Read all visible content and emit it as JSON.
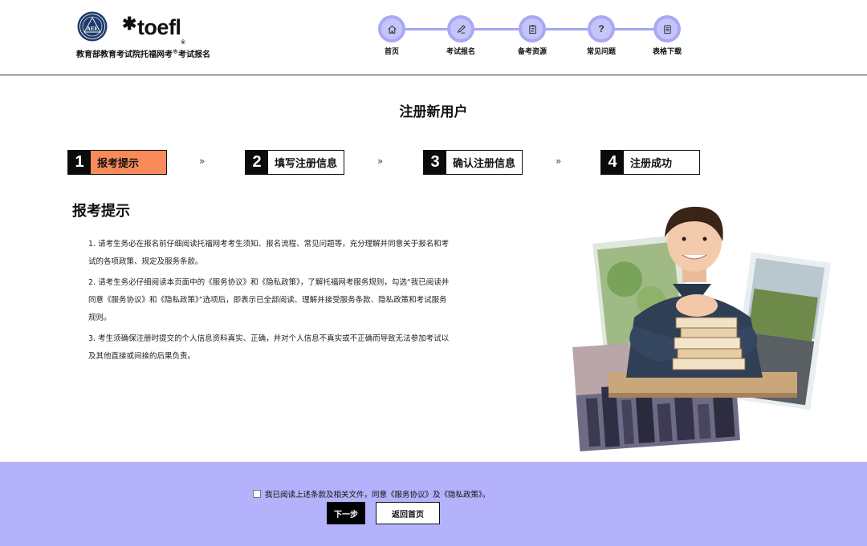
{
  "header": {
    "aee_logo_text": "AEE",
    "toefl_logo": "toefl",
    "org_name_prefix": "教育部教育考试院托福网考",
    "org_name_reg": "®",
    "org_name_suffix": "考试报名",
    "nav": [
      {
        "label": "首页",
        "icon": "home-icon"
      },
      {
        "label": "考试报名",
        "icon": "pencil-edit-icon"
      },
      {
        "label": "备考资源",
        "icon": "clipboard-icon"
      },
      {
        "label": "常见问题",
        "icon": "question-icon"
      },
      {
        "label": "表格下载",
        "icon": "document-icon"
      }
    ]
  },
  "page": {
    "title": "注册新用户",
    "steps": [
      {
        "num": "1",
        "label": "报考提示",
        "active": true
      },
      {
        "num": "2",
        "label": "填写注册信息",
        "active": false
      },
      {
        "num": "3",
        "label": "确认注册信息",
        "active": false
      },
      {
        "num": "4",
        "label": "注册成功",
        "active": false
      }
    ],
    "step_separator": "»",
    "section_title": "报考提示",
    "notes": [
      "1. 请考生务必在报名前仔细阅读托福网考考生须知、报名流程、常见问题等，充分理解并同意关于报名和考试的各项政策、规定及服务条款。",
      "2. 请考生务必仔细阅读本页面中的《服务协议》和《隐私政策》，了解托福网考服务规则，勾选“我已阅读并同意《服务协议》和《隐私政策》”选项后，即表示已全部阅读、理解并接受服务条款、隐私政策和考试服务规则。",
      "3. 考生须确保注册时提交的个人信息资料真实、正确，并对个人信息不真实或不正确而导致无法参加考试以及其他直接或间接的后果负责。"
    ]
  },
  "footer": {
    "agree_text": "我已阅读上述条款及相关文件，同意《服务协议》及《隐私政策》。",
    "agree_checked": false,
    "next_label": "下一步",
    "home_label": "返回首页"
  },
  "colors": {
    "accent_purple": "#b3b2fb",
    "nav_circle": "#a9a8f5",
    "active_step": "#f98b5a"
  }
}
